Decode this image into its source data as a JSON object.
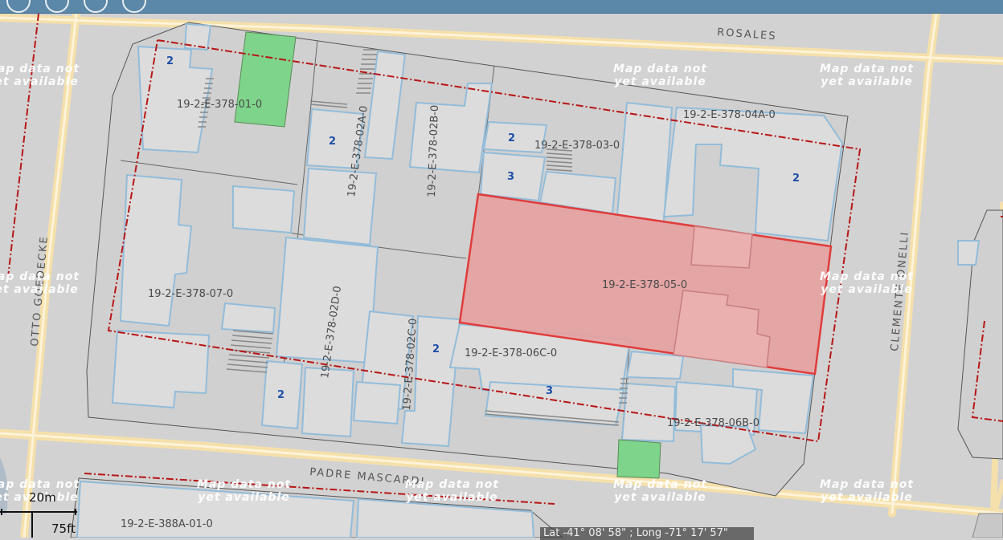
{
  "toolbar": {
    "buttons": [
      "zoom-in",
      "zoom-out",
      "home",
      "locate"
    ]
  },
  "streets": {
    "rosales": "ROSALES",
    "padre_mascardi": "PADRE MASCARDI",
    "otto_goedecke": "OTTO GOEDECKE",
    "clemente_onelli": "CLEMENTE ONELLI"
  },
  "watermark": {
    "text": "Map data not\nyet available"
  },
  "parcels": {
    "p01": "19-2-E-378-01-0",
    "p02a": "19-2-E-378-02A-0",
    "p02b": "19-2-E-378-02B-0",
    "p03": "19-2-E-378-03-0",
    "p04a": "19-2-E-378-04A-0",
    "p05": "19-2-E-378-05-0",
    "p07": "19-2-E-378-07-0",
    "p02d": "19-2-E-378-02D-0",
    "p02c": "19-2-E-378-02C-0",
    "p06c": "19-2-E-378-06C-0",
    "p06b": "19-2-E-378-06B-0",
    "p388a": "19-2-E-388A-01-0"
  },
  "floor_counts": {
    "a": "2",
    "b": "2",
    "c": "2",
    "d": "3",
    "e": "2",
    "f": "2",
    "g": "2",
    "h": "3"
  },
  "scale": {
    "metric": "20m",
    "imperial": "75ft"
  },
  "coordinates": "Lat -41° 08' 58\" ; Long -71° 17' 57\"",
  "colors": {
    "selected_fill": "#e89a9a",
    "selected_stroke": "#e03c3c",
    "green_space": "#7ed48a",
    "building_stroke": "#8fb8d8",
    "block_boundary": "#c00000",
    "road": "#f7e3b0"
  }
}
